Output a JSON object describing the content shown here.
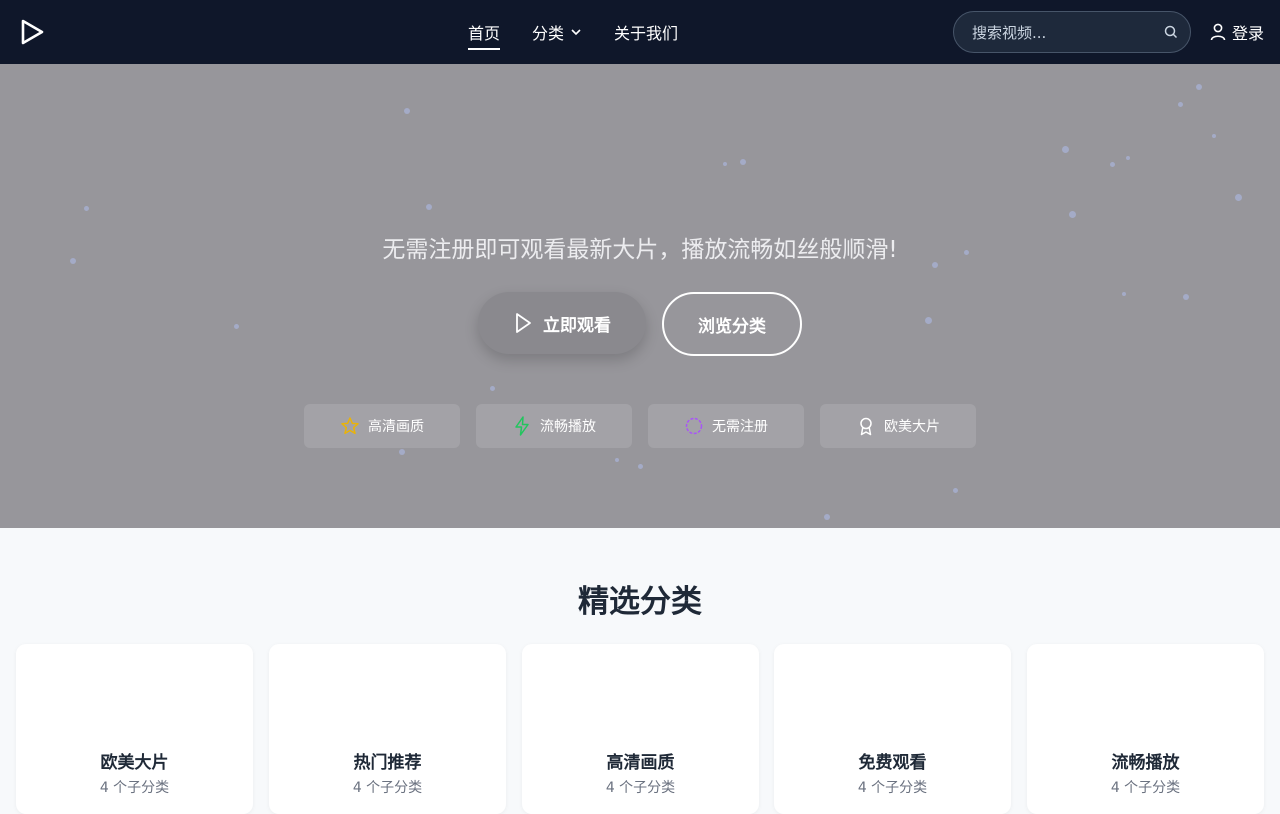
{
  "nav": {
    "links": [
      {
        "label": "首页"
      },
      {
        "label": "分类"
      },
      {
        "label": "关于我们"
      }
    ],
    "search_placeholder": "搜索视频...",
    "login_label": "登录"
  },
  "hero": {
    "tagline": "无需注册即可观看最新大片，播放流畅如丝般顺滑!",
    "watch_label": "立即观看",
    "browse_label": "浏览分类",
    "features": [
      {
        "label": "高清画质",
        "icon": "star-icon",
        "color": "#eab308"
      },
      {
        "label": "流畅播放",
        "icon": "lightning-icon",
        "color": "#22c55e"
      },
      {
        "label": "无需注册",
        "icon": "circle-icon",
        "color": "#a855f7"
      },
      {
        "label": "欧美大片",
        "icon": "award-icon",
        "color": "#ffffff"
      }
    ]
  },
  "section": {
    "title": "精选分类",
    "categories": [
      {
        "title": "欧美大片",
        "subtitle": "4 个子分类"
      },
      {
        "title": "热门推荐",
        "subtitle": "4 个子分类"
      },
      {
        "title": "高清画质",
        "subtitle": "4 个子分类"
      },
      {
        "title": "免费观看",
        "subtitle": "4 个子分类"
      },
      {
        "title": "流畅播放",
        "subtitle": "4 个子分类"
      }
    ]
  },
  "colors": {
    "navbar_bg": "#0f172a",
    "hero_bg": "#97969b"
  }
}
